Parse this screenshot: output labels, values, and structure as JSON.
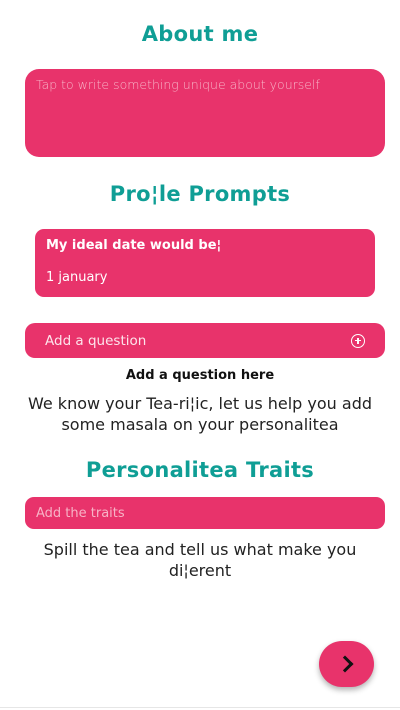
{
  "about": {
    "heading": "About me",
    "placeholder": "Tap to write something unique about yourself"
  },
  "prompts": {
    "heading": "Pro¦le Prompts",
    "card": {
      "question": "My ideal date would be¦",
      "answer": "1 january"
    },
    "add_question_label": "Add a question",
    "add_question_caption": "Add a question here",
    "description": "We know your Tea-ri¦ic, let us help you add some masala on your personalitea"
  },
  "traits": {
    "heading": "Personalitea Traits",
    "placeholder": "Add the traits",
    "description": "Spill the tea and tell us what make you di¦erent"
  },
  "next_button": {
    "icon": "chevron-right-icon"
  },
  "colors": {
    "accent": "#e8336b",
    "heading": "#0f9e95"
  }
}
